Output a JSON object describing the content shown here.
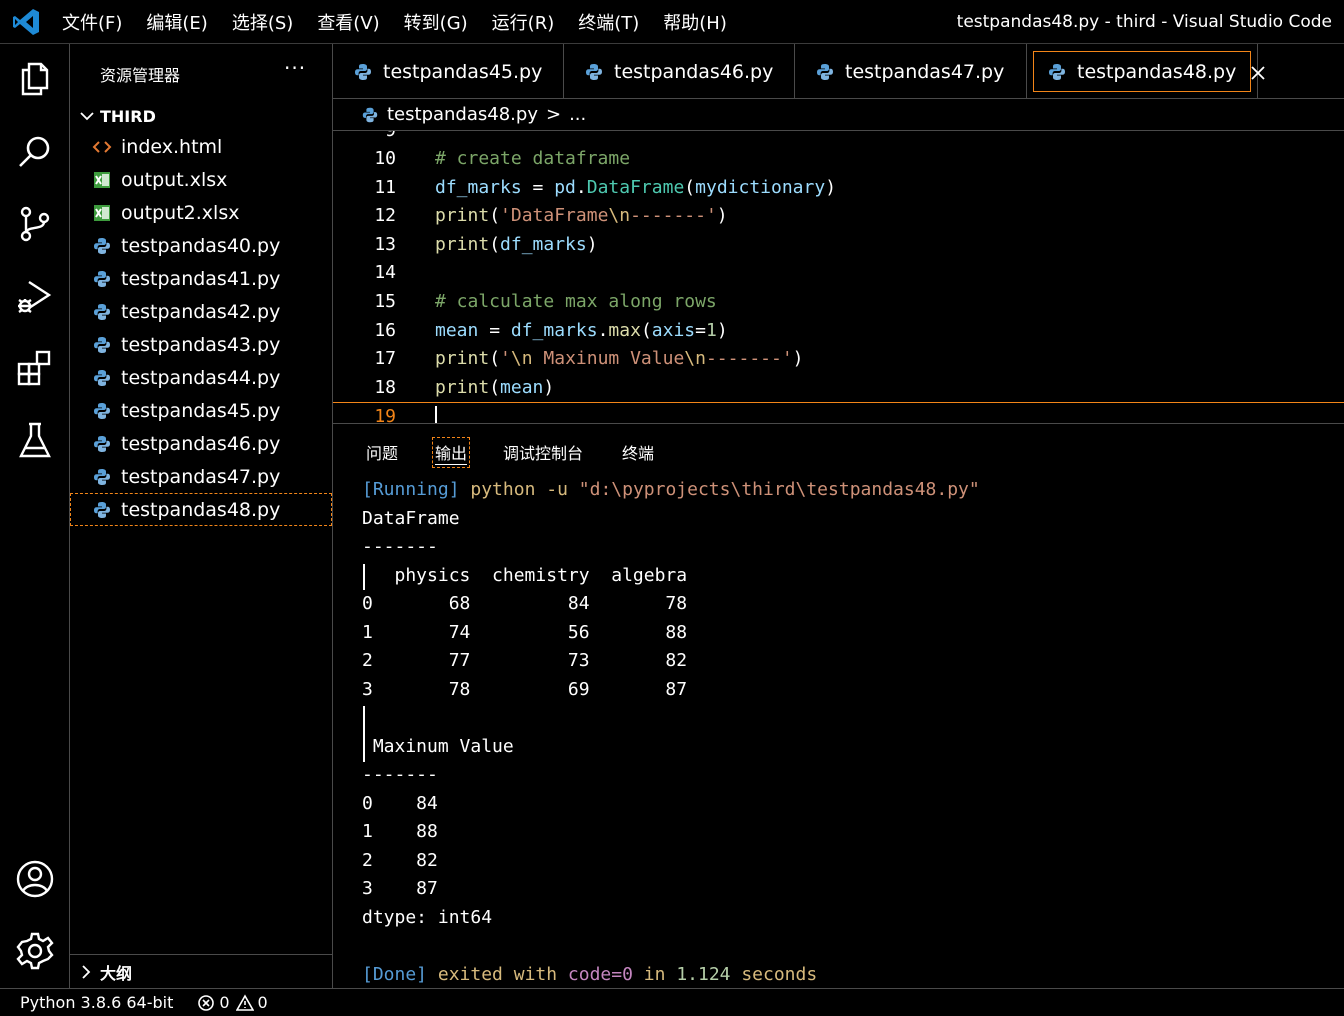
{
  "titlebar": {
    "menu": [
      "文件(F)",
      "编辑(E)",
      "选择(S)",
      "查看(V)",
      "转到(G)",
      "运行(R)",
      "终端(T)",
      "帮助(H)"
    ],
    "window_title": "testpandas48.py - third - Visual Studio Code"
  },
  "activitybar": {
    "icons": [
      "explorer-icon",
      "search-icon",
      "source-control-icon",
      "run-debug-icon",
      "extensions-icon",
      "testing-icon",
      "account-icon",
      "settings-gear-icon"
    ]
  },
  "sidebar": {
    "title": "资源管理器",
    "more": "···",
    "folder": "THIRD",
    "files": [
      {
        "name": "index.html",
        "type": "html"
      },
      {
        "name": "output.xlsx",
        "type": "excel"
      },
      {
        "name": "output2.xlsx",
        "type": "excel"
      },
      {
        "name": "testpandas40.py",
        "type": "python"
      },
      {
        "name": "testpandas41.py",
        "type": "python"
      },
      {
        "name": "testpandas42.py",
        "type": "python"
      },
      {
        "name": "testpandas43.py",
        "type": "python"
      },
      {
        "name": "testpandas44.py",
        "type": "python"
      },
      {
        "name": "testpandas45.py",
        "type": "python"
      },
      {
        "name": "testpandas46.py",
        "type": "python"
      },
      {
        "name": "testpandas47.py",
        "type": "python"
      },
      {
        "name": "testpandas48.py",
        "type": "python",
        "selected": true
      }
    ],
    "outline": "大纲"
  },
  "tabs": [
    {
      "label": "testpandas45.py"
    },
    {
      "label": "testpandas46.py"
    },
    {
      "label": "testpandas47.py"
    },
    {
      "label": "testpandas48.py",
      "active": true
    }
  ],
  "breadcrumb": {
    "file": "testpandas48.py",
    "separator": ">",
    "rest": "..."
  },
  "editor": {
    "lines": [
      {
        "n": "10",
        "tokens": [
          [
            "# create dataframe",
            "comment"
          ]
        ]
      },
      {
        "n": "11",
        "tokens": [
          [
            "df_marks",
            "var"
          ],
          [
            " = ",
            "plain"
          ],
          [
            "pd",
            "var"
          ],
          [
            ".",
            "plain"
          ],
          [
            "DataFrame",
            "class"
          ],
          [
            "(",
            "plain"
          ],
          [
            "mydictionary",
            "var"
          ],
          [
            ")",
            "plain"
          ]
        ]
      },
      {
        "n": "12",
        "tokens": [
          [
            "print",
            "func"
          ],
          [
            "(",
            "plain"
          ],
          [
            "'DataFrame",
            "str"
          ],
          [
            "\\n",
            "esc"
          ],
          [
            "-------'",
            "str"
          ],
          [
            ")",
            "plain"
          ]
        ]
      },
      {
        "n": "13",
        "tokens": [
          [
            "print",
            "func"
          ],
          [
            "(",
            "plain"
          ],
          [
            "df_marks",
            "var"
          ],
          [
            ")",
            "plain"
          ]
        ]
      },
      {
        "n": "14",
        "tokens": []
      },
      {
        "n": "15",
        "tokens": [
          [
            "# calculate max along rows",
            "comment"
          ]
        ]
      },
      {
        "n": "16",
        "tokens": [
          [
            "mean",
            "var"
          ],
          [
            " = ",
            "plain"
          ],
          [
            "df_marks",
            "var"
          ],
          [
            ".",
            "plain"
          ],
          [
            "max",
            "func"
          ],
          [
            "(",
            "plain"
          ],
          [
            "axis",
            "var"
          ],
          [
            "=",
            "plain"
          ],
          [
            "1",
            "num"
          ],
          [
            ")",
            "plain"
          ]
        ]
      },
      {
        "n": "17",
        "tokens": [
          [
            "print",
            "func"
          ],
          [
            "(",
            "plain"
          ],
          [
            "'",
            "str"
          ],
          [
            "\\n",
            "esc"
          ],
          [
            " Maxinum Value",
            "str"
          ],
          [
            "\\n",
            "esc"
          ],
          [
            "-------'",
            "str"
          ],
          [
            ")",
            "plain"
          ]
        ]
      },
      {
        "n": "18",
        "tokens": [
          [
            "print",
            "func"
          ],
          [
            "(",
            "plain"
          ],
          [
            "mean",
            "var"
          ],
          [
            ")",
            "plain"
          ]
        ]
      },
      {
        "n": "19",
        "tokens": [],
        "current": true
      }
    ]
  },
  "panel": {
    "tabs": [
      "问题",
      "输出",
      "调试控制台",
      "终端"
    ],
    "active_tab": "输出",
    "output": [
      {
        "tokens": [
          [
            "[Running]",
            "blue"
          ],
          [
            " python -u ",
            "yellow"
          ],
          [
            "\"d:\\pyprojects\\third\\testpandas48.py\"",
            "str"
          ]
        ]
      },
      {
        "tokens": [
          [
            "DataFrame",
            "plain"
          ]
        ]
      },
      {
        "tokens": [
          [
            "-------",
            "plain"
          ]
        ]
      },
      {
        "tokens": [
          [
            "   physics  chemistry  algebra",
            "plain"
          ]
        ]
      },
      {
        "tokens": [
          [
            "0       68         84       78",
            "plain"
          ]
        ]
      },
      {
        "tokens": [
          [
            "1       74         56       88",
            "plain"
          ]
        ]
      },
      {
        "tokens": [
          [
            "2       77         73       82",
            "plain"
          ]
        ]
      },
      {
        "tokens": [
          [
            "3       78         69       87",
            "plain"
          ]
        ]
      },
      {
        "tokens": [
          [
            "",
            "plain"
          ]
        ]
      },
      {
        "tokens": [
          [
            " Maxinum Value",
            "plain"
          ]
        ]
      },
      {
        "tokens": [
          [
            "-------",
            "plain"
          ]
        ]
      },
      {
        "tokens": [
          [
            "0    84",
            "plain"
          ]
        ]
      },
      {
        "tokens": [
          [
            "1    88",
            "plain"
          ]
        ]
      },
      {
        "tokens": [
          [
            "2    82",
            "plain"
          ]
        ]
      },
      {
        "tokens": [
          [
            "3    87",
            "plain"
          ]
        ]
      },
      {
        "tokens": [
          [
            "dtype: int64",
            "plain"
          ]
        ]
      },
      {
        "tokens": [
          [
            "",
            "plain"
          ]
        ]
      },
      {
        "tokens": [
          [
            "[Done]",
            "blue"
          ],
          [
            " exited with ",
            "yellow"
          ],
          [
            "code=0",
            "purple"
          ],
          [
            " in ",
            "yellow"
          ],
          [
            "1.124",
            "num"
          ],
          [
            " seconds",
            "yellow"
          ]
        ]
      }
    ]
  },
  "statusbar": {
    "python": "Python 3.8.6 64-bit",
    "errors": "0",
    "warnings": "0"
  },
  "colors": {
    "accent_focus": "#f38518",
    "background": "#000000",
    "border": "#4a4a4a"
  }
}
